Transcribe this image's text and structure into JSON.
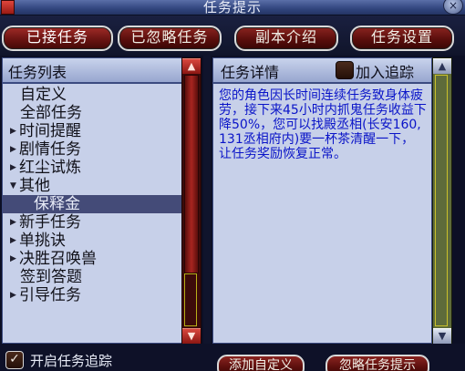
{
  "window": {
    "title": "任务提示",
    "close_symbol": "×"
  },
  "tabs": [
    {
      "label": "已接任务",
      "active": true
    },
    {
      "label": "已忽略任务",
      "active": false
    },
    {
      "label": "副本介绍",
      "active": false
    },
    {
      "label": "任务设置",
      "active": false
    }
  ],
  "task_list": {
    "header": "任务列表",
    "items": [
      {
        "label": "自定义",
        "arrow": ""
      },
      {
        "label": "全部任务",
        "arrow": ""
      },
      {
        "label": "时间提醒",
        "arrow": "▶"
      },
      {
        "label": "剧情任务",
        "arrow": "▶"
      },
      {
        "label": "红尘试炼",
        "arrow": "▶"
      },
      {
        "label": "其他",
        "arrow": "▼"
      },
      {
        "label": "保释金",
        "arrow": ""
      },
      {
        "label": "新手任务",
        "arrow": "▶"
      },
      {
        "label": "单挑诀",
        "arrow": "▶"
      },
      {
        "label": "决胜召唤兽",
        "arrow": "▶"
      },
      {
        "label": "签到答题",
        "arrow": ""
      },
      {
        "label": "引导任务",
        "arrow": "▶"
      }
    ],
    "selected_index": 6,
    "scroll_up_symbol": "▲",
    "scroll_down_symbol": "▼"
  },
  "detail": {
    "header": "任务详情",
    "track_checkbox_label": "加入追踪",
    "text": "您的角色因长时间连续任务致身体疲劳，接下来45小时内抓鬼任务收益下降50%，您可以找殿丞相(长安160,131丞相府内)要一杯茶清醒一下，让任务奖励恢复正常。",
    "text_color": "#0a14c8",
    "scroll_up_symbol": "▲",
    "scroll_down_symbol": "▼"
  },
  "bottom": {
    "track_checkbox_label": "开启任务追踪",
    "track_checked": true,
    "check_symbol": "✓",
    "add_custom_button": "添加自定义",
    "ignore_button": "忽略任务提示"
  },
  "colors": {
    "tab_fill": "#6a1412",
    "panel_fill": "#c7d0e9",
    "header_fill": "#c9d3ec",
    "selection": "#444b78"
  },
  "icons": {
    "title_icon": "app-logo-icon",
    "close": "close-icon",
    "resize": "resize-grip-icon"
  }
}
